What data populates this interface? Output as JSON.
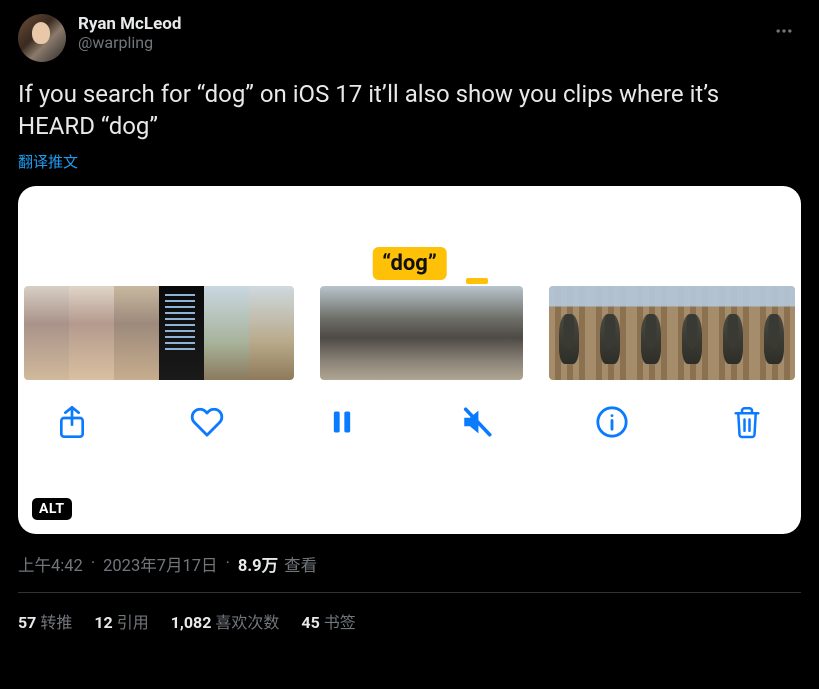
{
  "author": {
    "display_name": "Ryan McLeod",
    "handle": "@warpling"
  },
  "tweet": {
    "text": "If you search for “dog” on iOS 17 it’ll also show you clips where it’s HEARD “dog”",
    "translate_label": "翻译推文"
  },
  "media": {
    "search_term": "“dog”",
    "alt_badge": "ALT"
  },
  "meta": {
    "time": "上午4:42",
    "date": "2023年7月17日",
    "views_count": "8.9万",
    "views_label": "查看"
  },
  "stats": {
    "retweets_count": "57",
    "retweets_label": "转推",
    "quotes_count": "12",
    "quotes_label": "引用",
    "likes_count": "1,082",
    "likes_label": "喜欢次数",
    "bookmarks_count": "45",
    "bookmarks_label": "书签"
  }
}
